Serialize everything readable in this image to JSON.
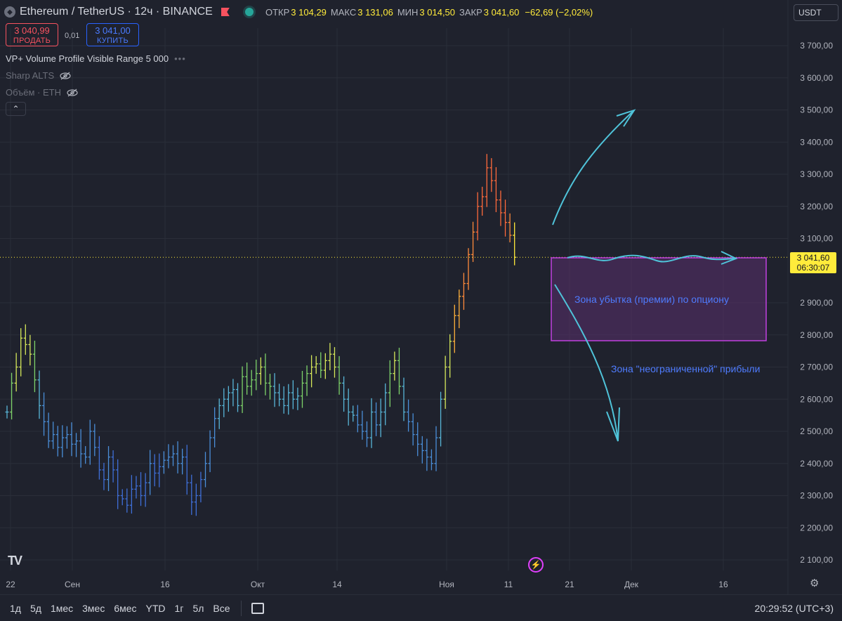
{
  "header": {
    "title": "Ethereum / TetherUS · 12ч · BINANCE",
    "symbol_icon": "ethereum-icon",
    "ohlc": [
      {
        "label": "ОТКР",
        "value": "3 104,29"
      },
      {
        "label": "МАКС",
        "value": "3 131,06"
      },
      {
        "label": "МИН",
        "value": "3 014,50"
      },
      {
        "label": "ЗАКР",
        "value": "3 041,60"
      }
    ],
    "change": "−62,69 (−2,02%)"
  },
  "trade": {
    "sell_price": "3 040,99",
    "sell_label": "ПРОДАТЬ",
    "spread": "0,01",
    "buy_price": "3 041,00",
    "buy_label": "КУПИТЬ"
  },
  "indicators": [
    {
      "label": "VP+ Volume Profile Visible Range 5 000"
    },
    {
      "label": "Sharp ALTS"
    },
    {
      "label": "Объём · ETH"
    }
  ],
  "currency_select": "USDT",
  "last_price": {
    "value": "3 041,60",
    "countdown": "06:30:07"
  },
  "annotations": {
    "loss_zone": "Зона убытка (премии) по опциону",
    "profit_zone": "Зона \"неограниченной\" прибыли"
  },
  "bottom_bar": {
    "ranges": [
      "1д",
      "5д",
      "1мес",
      "3мес",
      "6мес",
      "YTD",
      "1г",
      "5л",
      "Все"
    ],
    "clock": "20:29:52 (UTC+3)"
  },
  "colors": {
    "background": "#1f222d",
    "grid": "#2a2e39",
    "last_price_line": "#ffeb3b",
    "zone_border": "#c040e0",
    "zone_fill": "#5a2f6e",
    "arrow": "#4fc3d9"
  },
  "chart_data": {
    "type": "ohlc",
    "title": "",
    "xlabel": "",
    "ylabel": "",
    "ylim": [
      2080,
      3760
    ],
    "y_ticks": [
      "3 700,00",
      "3 600,00",
      "3 500,00",
      "3 400,00",
      "3 300,00",
      "3 200,00",
      "3 100,00",
      "2 900,00",
      "2 800,00",
      "2 700,00",
      "2 600,00",
      "2 500,00",
      "2 400,00",
      "2 300,00",
      "2 200,00",
      "2 100,00"
    ],
    "y_tick_values": [
      3700,
      3600,
      3500,
      3400,
      3300,
      3200,
      3100,
      2900,
      2800,
      2700,
      2600,
      2500,
      2400,
      2300,
      2200,
      2100
    ],
    "x_ticks": [
      "22",
      "Сен",
      "16",
      "Окт",
      "14",
      "Ноя",
      "11",
      "21",
      "Дек",
      "16"
    ],
    "x_tick_bar_index": [
      1,
      13,
      29,
      46,
      60,
      79,
      90,
      101,
      112,
      128
    ],
    "last_close": 3041.6,
    "bars_count": 96,
    "closes": [
      2560,
      2650,
      2700,
      2790,
      2770,
      2740,
      2660,
      2580,
      2530,
      2470,
      2490,
      2450,
      2480,
      2490,
      2460,
      2470,
      2430,
      2420,
      2500,
      2450,
      2380,
      2350,
      2420,
      2380,
      2300,
      2290,
      2270,
      2320,
      2330,
      2300,
      2340,
      2400,
      2370,
      2390,
      2410,
      2420,
      2430,
      2400,
      2420,
      2340,
      2280,
      2300,
      2350,
      2400,
      2480,
      2540,
      2580,
      2600,
      2620,
      2630,
      2580,
      2670,
      2640,
      2660,
      2680,
      2700,
      2650,
      2640,
      2620,
      2600,
      2580,
      2620,
      2600,
      2610,
      2650,
      2680,
      2700,
      2710,
      2690,
      2720,
      2740,
      2700,
      2650,
      2600,
      2560,
      2550,
      2520,
      2500,
      2480,
      2560,
      2520,
      2560,
      2620,
      2680,
      2720,
      2640,
      2560,
      2530,
      2490,
      2460,
      2440,
      2420,
      2400,
      2480,
      2600,
      2700,
      2780,
      2860,
      2920,
      2960,
      3050,
      3120,
      3200,
      3230,
      3320,
      3280,
      3220,
      3180,
      3150,
      3110,
      3041.6
    ]
  }
}
